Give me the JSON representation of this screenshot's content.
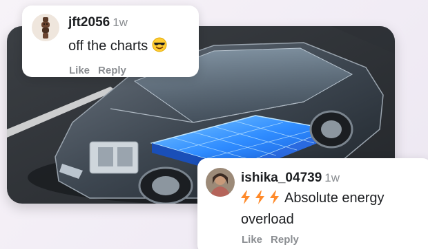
{
  "hero": {
    "image_icon": "electric-car-battery-illustration-icon"
  },
  "comments": [
    {
      "username": "jft2056",
      "time": "1w",
      "text": "off the charts",
      "emoji_icon": "smiling-face-with-sunglasses-icon",
      "like_label": "Like",
      "reply_label": "Reply"
    },
    {
      "username": "ishika_04739",
      "time": "1w",
      "lead_icons": [
        "high-voltage-icon",
        "high-voltage-icon",
        "high-voltage-icon"
      ],
      "text": "Absolute energy overload",
      "like_label": "Like",
      "reply_label": "Reply"
    }
  ],
  "colors": {
    "background": "#f3eef6",
    "meta_gray": "#8a8d91",
    "text": "#1c1e21",
    "battery_blue": "#2f8cff",
    "bolt_orange": "#ff8a2a"
  }
}
